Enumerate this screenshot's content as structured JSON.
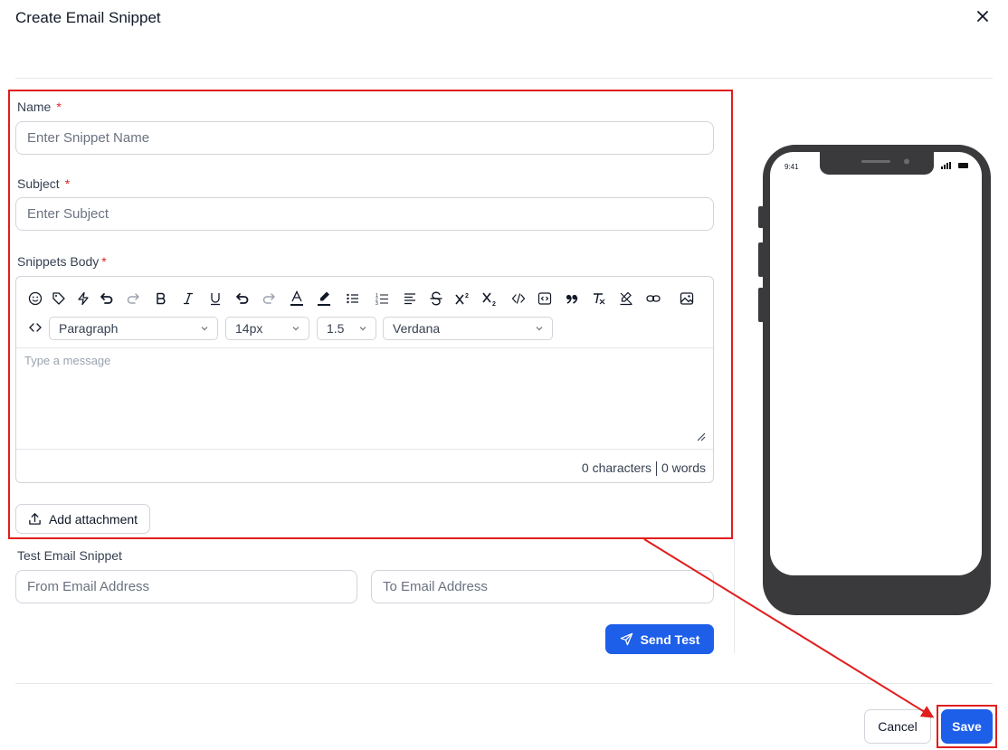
{
  "dialog": {
    "title": "Create Email Snippet"
  },
  "form": {
    "name_label": "Name",
    "name_placeholder": "Enter Snippet Name",
    "subject_label": "Subject",
    "subject_placeholder": "Enter Subject",
    "body_label": "Snippets Body",
    "required_mark": "*"
  },
  "editor": {
    "toolbar_icons": [
      "smiley-icon",
      "tag-icon",
      "bolt-icon",
      "undo-icon",
      "redo-icon",
      "bold-icon",
      "italic-icon",
      "underline-icon",
      "undo-icon",
      "redo-icon",
      "text-color-icon",
      "highlight-icon",
      "bullet-list-icon",
      "numbered-list-icon",
      "align-icon",
      "strikethrough-icon",
      "superscript-icon",
      "subscript-icon",
      "code-icon",
      "code-block-icon",
      "quote-icon",
      "clear-format-icon",
      "clear-highlight-icon",
      "link-icon",
      "image-icon"
    ],
    "paragraph": "Paragraph",
    "font_size": "14px",
    "line_height": "1.5",
    "font_family": "Verdana",
    "message_placeholder": "Type a message",
    "characters": "0 characters",
    "words": "0 words"
  },
  "attachment": {
    "label": "Add attachment"
  },
  "test": {
    "label": "Test Email Snippet",
    "from_placeholder": "From Email Address",
    "to_placeholder": "To Email Address",
    "send_label": "Send Test"
  },
  "phone": {
    "time": "9:41"
  },
  "footer": {
    "cancel_label": "Cancel",
    "save_label": "Save"
  },
  "colors": {
    "primary": "#1d5fe8",
    "annotation": "#e11d1d",
    "required": "#dc2626"
  }
}
